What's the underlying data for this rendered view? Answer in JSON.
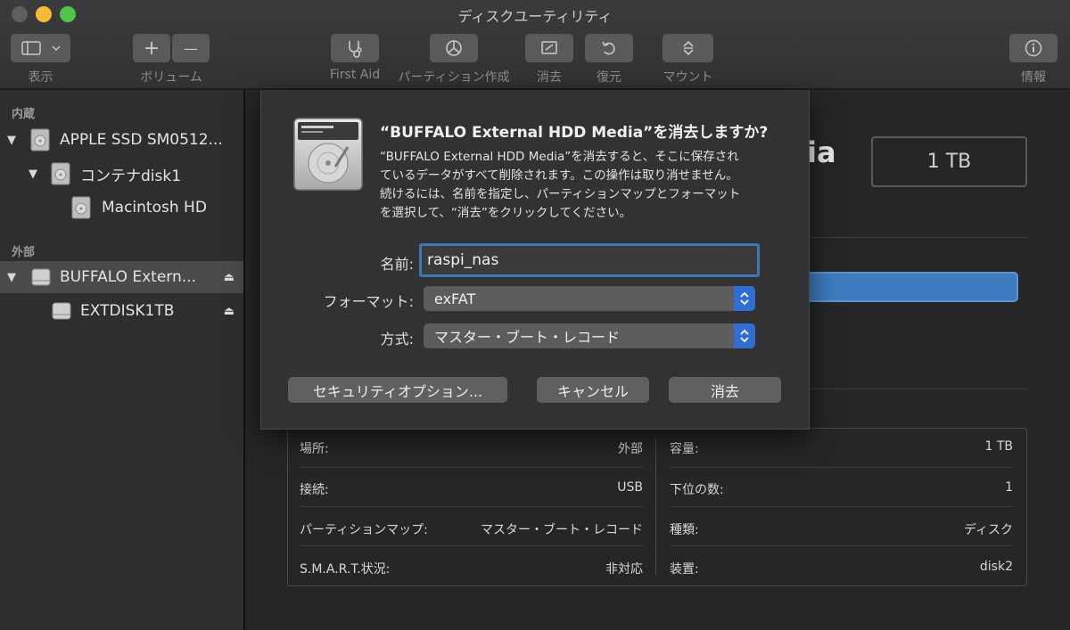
{
  "window": {
    "title": "ディスクユーティリティ"
  },
  "toolbar": {
    "view_label": "表示",
    "volume_label": "ボリューム",
    "firstaid_label": "First Aid",
    "partition_label": "パーティション作成",
    "erase_label": "消去",
    "restore_label": "復元",
    "mount_label": "マウント",
    "info_label": "情報",
    "add_symbol": "+",
    "remove_symbol": "—"
  },
  "sidebar": {
    "internal_header": "内蔵",
    "external_header": "外部",
    "items": [
      {
        "label": "APPLE SSD SM0512..."
      },
      {
        "label": "コンテナdisk1"
      },
      {
        "label": "Macintosh HD"
      },
      {
        "label": "BUFFALO Extern..."
      },
      {
        "label": "EXTDISK1TB"
      }
    ]
  },
  "main": {
    "title_fragment": "ia",
    "capacity": "1 TB",
    "info": {
      "location_label": "場所:",
      "location_value": "外部",
      "connection_label": "接続:",
      "connection_value": "USB",
      "partition_map_label": "パーティションマップ:",
      "partition_map_value": "マスター・ブート・レコード",
      "smart_label": "S.M.A.R.T.状況:",
      "smart_value": "非対応",
      "capacity_label": "容量:",
      "capacity_value": "1 TB",
      "children_label": "下位の数:",
      "children_value": "1",
      "type_label": "種類:",
      "type_value": "ディスク",
      "device_label": "装置:",
      "device_value": "disk2"
    }
  },
  "sheet": {
    "title": "“BUFFALO External HDD Media”を消去しますか?",
    "body_lines": [
      "“BUFFALO External HDD Media”を消去すると、そこに保存され",
      "ているデータがすべて削除されます。この操作は取り消せません。",
      "続けるには、名前を指定し、パーティションマップとフォーマット",
      "を選択して、“消去”をクリックしてください。"
    ],
    "name_label": "名前:",
    "name_value": "raspi_nas",
    "format_label": "フォーマット:",
    "format_value": "exFAT",
    "scheme_label": "方式:",
    "scheme_value": "マスター・ブート・レコード",
    "security_button": "セキュリティオプション...",
    "cancel_button": "キャンセル",
    "erase_button": "消去"
  },
  "colors": {
    "accent": "#2f6fd4",
    "focus_ring": "#3c78b4",
    "usage_bar": "#3d7dbf"
  }
}
